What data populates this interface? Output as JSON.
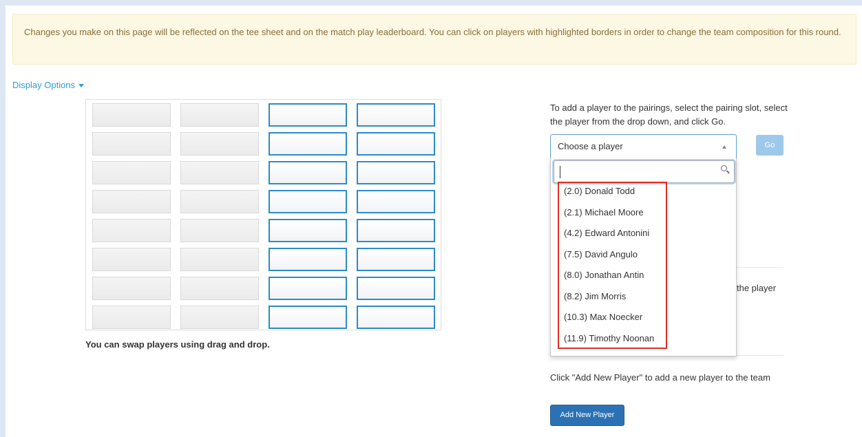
{
  "alert": {
    "message": "Changes you make on this page will be reflected on the tee sheet and on the match play leaderboard. You can click on players with highlighted borders in order to change the team composition for this round."
  },
  "display_options": {
    "label": "Display Options"
  },
  "pairing_grid": {
    "rows": 8,
    "columns": 4,
    "open_columns": [
      3,
      4
    ]
  },
  "swap_note": "You can swap players using drag and drop.",
  "add_player_panel": {
    "instructions": "To add a player to the pairings, select the pairing slot, select the player from the drop down, and click Go.",
    "select": {
      "value": "Choose a player",
      "search_value": ""
    },
    "go_label": "Go",
    "players": [
      "(2.0) Donald Todd",
      "(2.1) Michael Moore",
      "(4.2) Edward Antonini",
      "(7.5) David Angulo",
      "(8.0) Jonathan Antin",
      "(8.2) Jim Morris",
      "(10.3) Max Noecker",
      "(11.9) Timothy Noonan"
    ],
    "partial_text": "the player"
  },
  "new_player": {
    "note": "Click \"Add New Player\" to add a new player to the team",
    "button_label": "Add New Player"
  },
  "colors": {
    "accent": "#2a9fd6",
    "open_slot_border": "#2a8ac9",
    "highlight": "#e02f1f",
    "alert_bg": "#fcf8e3",
    "alert_text": "#8a6d3b"
  }
}
